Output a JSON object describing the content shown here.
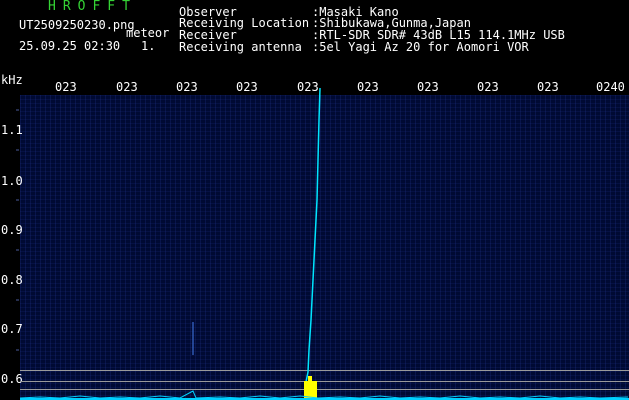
{
  "header": {
    "logo": "HROFFT",
    "file_name": "UT2509250230.png",
    "tag": "meteor",
    "datetime": "25.09.25 02:30",
    "counter": "1.",
    "labels": [
      "Observer",
      "Receiving Location",
      "Receiver",
      "Receiving antenna"
    ],
    "values": [
      ":Masaki Kano",
      ":Shibukawa,Gunma,Japan",
      ":RTL-SDR SDR# 43dB L15 114.1MHz USB",
      ":5el Yagi Az 20 for Aomori VOR"
    ]
  },
  "axis": {
    "y_unit": "kHz",
    "x_ticks": [
      "023",
      "023",
      "023",
      "023",
      "023",
      "023",
      "023",
      "023",
      "023",
      "0240"
    ],
    "y_ticks": [
      "1.1",
      "1.0",
      "0.9",
      "0.8",
      "0.7",
      "0.6"
    ]
  },
  "colors": {
    "background": "#000a33",
    "trace": "#00e6ff",
    "signal": "#ffff00",
    "text": "#ffffff",
    "logo": "#35d335"
  }
}
